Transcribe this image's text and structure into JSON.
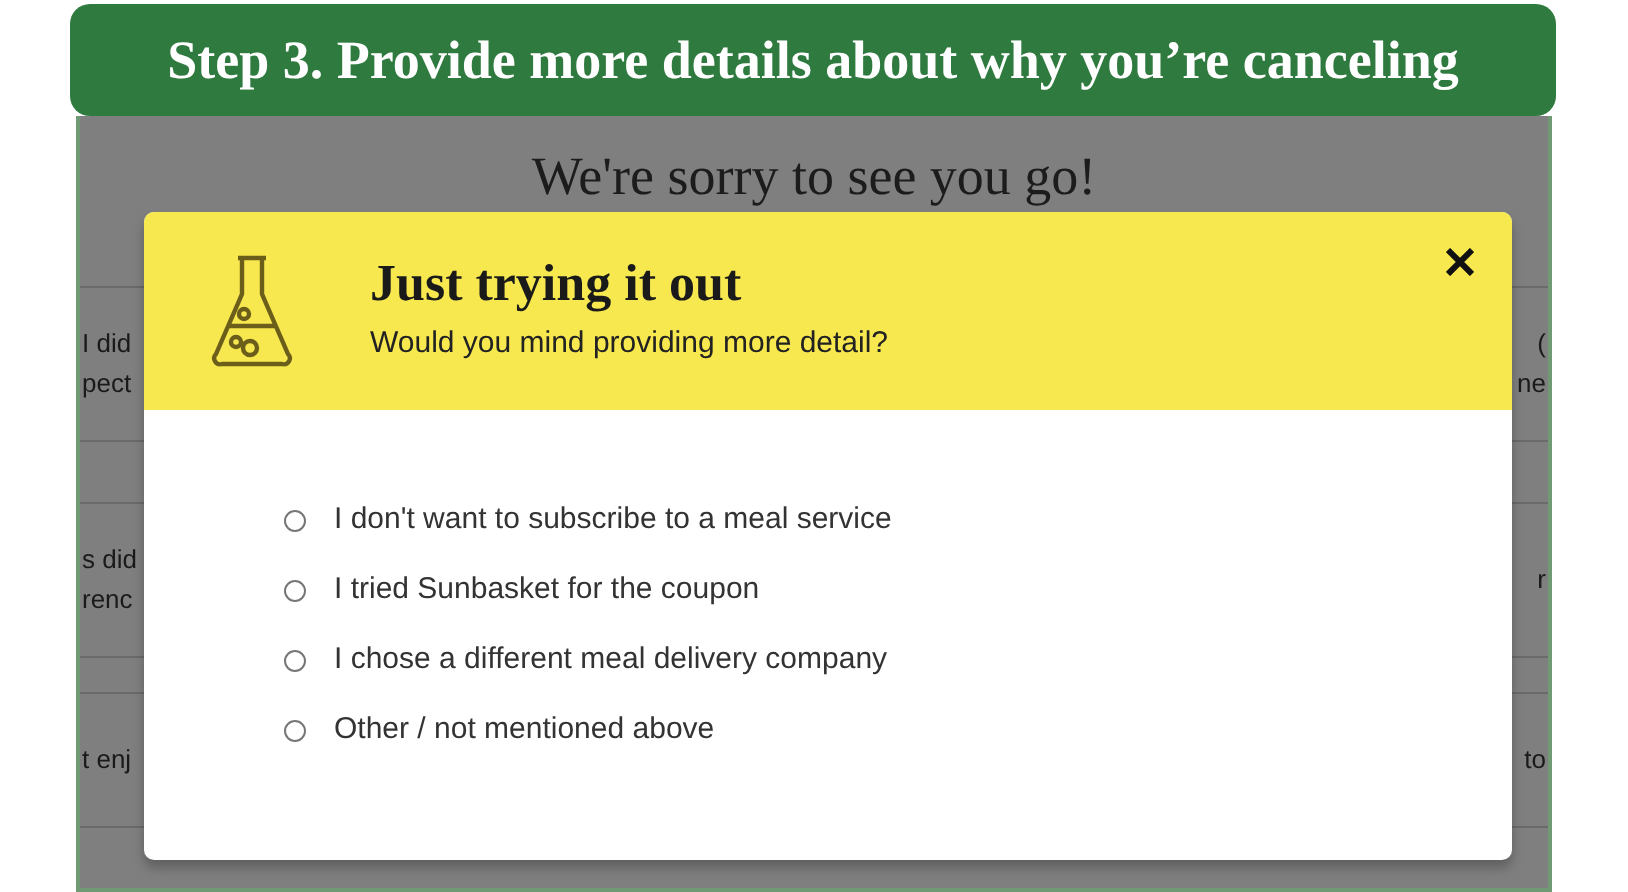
{
  "banner": {
    "title": "Step 3. Provide more details about why you’re canceling"
  },
  "page": {
    "heading": "We're sorry to see you go!",
    "rows": [
      {
        "left": [
          "I did",
          "pect"
        ],
        "right": [
          "(",
          "ne"
        ]
      },
      {
        "left": [
          "s did",
          "renc"
        ],
        "right": [
          "r"
        ]
      },
      {
        "left": [
          "t enj"
        ],
        "right": [
          "to"
        ]
      }
    ]
  },
  "modal": {
    "title": "Just trying it out",
    "subtitle": "Would you mind providing more detail?",
    "options": [
      {
        "label": "I don't want to subscribe to a meal service",
        "selected": false
      },
      {
        "label": "I tried Sunbasket for the coupon",
        "selected": false
      },
      {
        "label": "I chose a different meal delivery company",
        "selected": false
      },
      {
        "label": "Other / not mentioned above",
        "selected": false
      }
    ]
  }
}
